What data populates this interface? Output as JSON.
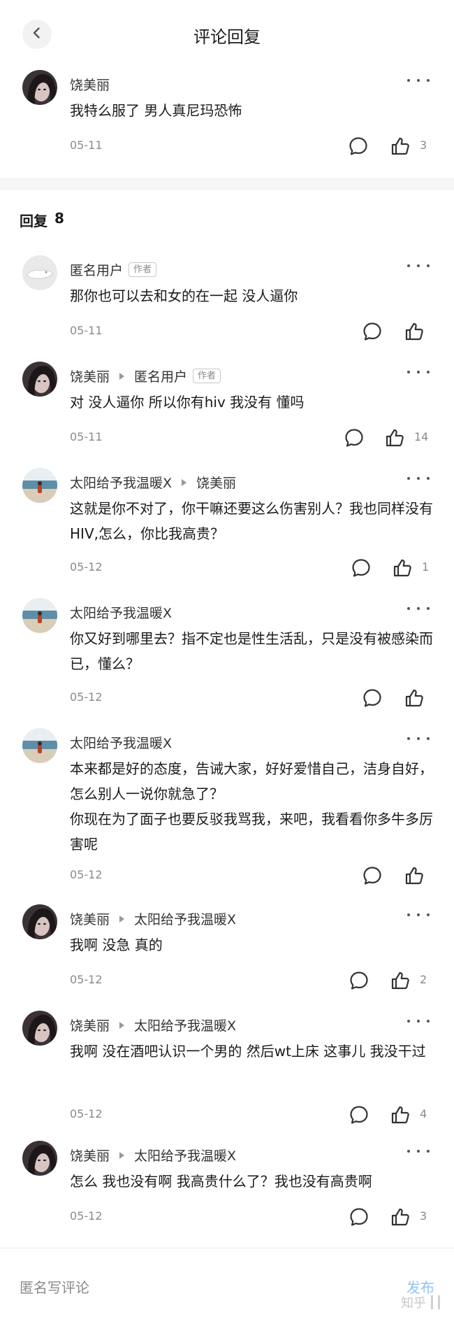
{
  "header": {
    "title": "评论回复"
  },
  "main_comment": {
    "author": "饶美丽",
    "text": "我特么服了 男人真尼玛恐怖",
    "date": "05-11",
    "likes": "3"
  },
  "replies_header": {
    "label": "回复",
    "count": "8"
  },
  "replies": [
    {
      "author": "匿名用户",
      "badge": "作者",
      "text": "那你也可以去和女的在一起 没人逼你",
      "date": "05-11",
      "likes": ""
    },
    {
      "author": "饶美丽",
      "target": "匿名用户",
      "target_badge": "作者",
      "text": "对 没人逼你 所以你有hiv 我没有 懂吗",
      "date": "05-11",
      "likes": "14"
    },
    {
      "author": "太阳给予我温暖X",
      "target": "饶美丽",
      "text": "这就是你不对了，你干嘛还要这么伤害别人？我也同样没有HIV,怎么，你比我高贵？",
      "date": "05-12",
      "likes": "1"
    },
    {
      "author": "太阳给予我温暖X",
      "text": "你又好到哪里去？指不定也是性生活乱，只是没有被感染而已，懂么？",
      "date": "05-12",
      "likes": ""
    },
    {
      "author": "太阳给予我温暖X",
      "text": "本来都是好的态度，告诫大家，好好爱惜自己，洁身自好，怎么别人一说你就急了？\n你现在为了面子也要反驳我骂我，来吧，我看看你多牛多厉害呢",
      "date": "05-12",
      "likes": ""
    },
    {
      "author": "饶美丽",
      "target": "太阳给予我温暖X",
      "text": "我啊 没急 真的",
      "date": "05-12",
      "likes": "2"
    },
    {
      "author": "饶美丽",
      "target": "太阳给予我温暖X",
      "text": "我啊 没在酒吧认识一个男的 然后wt上床 这事儿 我没干过",
      "date": "05-12",
      "likes": "4"
    },
    {
      "author": "饶美丽",
      "target": "太阳给予我温暖X",
      "text": "怎么 我也没有啊 我高贵什么了？我也没有高贵啊",
      "date": "05-12",
      "likes": "3"
    }
  ],
  "footer": {
    "placeholder": "匿名写评论",
    "publish": "发布",
    "watermark": "知乎"
  },
  "icons": {
    "back": "chevron-left-icon",
    "more": "more-dots-icon",
    "reply": "comment-bubble-icon",
    "like": "thumbs-up-icon"
  },
  "colors": {
    "publish": "#8ec5f5",
    "divider": "#f5f5f5",
    "meta_text": "#8a8a8a"
  }
}
